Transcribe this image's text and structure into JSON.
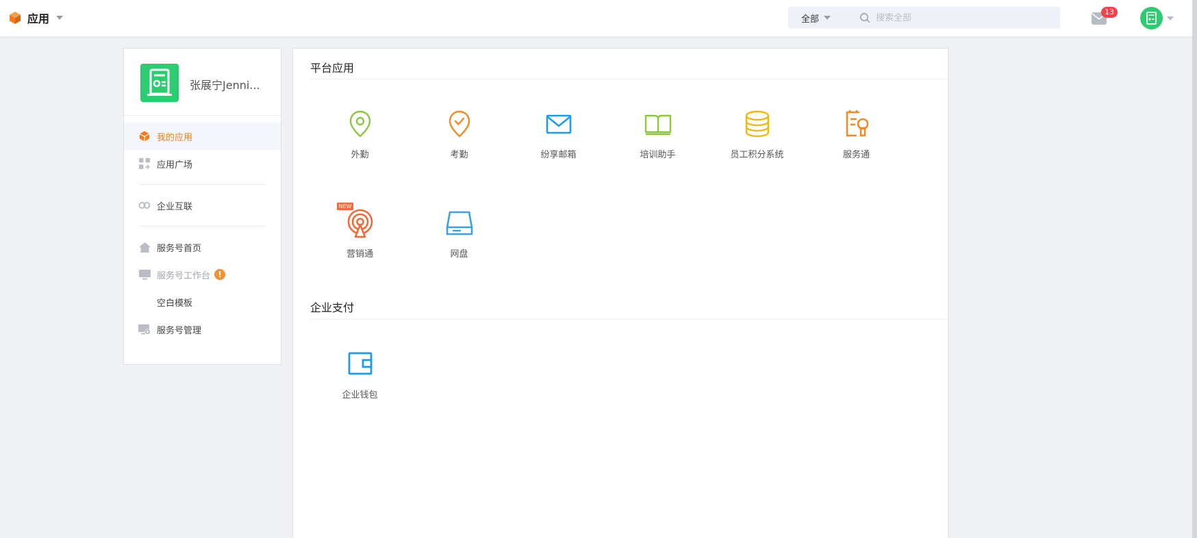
{
  "header": {
    "app_title": "应用",
    "search_scope": "全部",
    "search_placeholder": "搜索全部",
    "mail_badge": "13"
  },
  "sidebar": {
    "org_name": "张展宁Jenni...",
    "items": [
      {
        "label": "我的应用",
        "icon": "cube-icon",
        "active": true
      },
      {
        "label": "应用广场",
        "icon": "grid-plus-icon"
      },
      {
        "label": "企业互联",
        "icon": "link-icon"
      },
      {
        "label": "服务号首页",
        "icon": "home-icon"
      },
      {
        "label": "服务号工作台",
        "icon": "monitor-icon",
        "warning": "!"
      },
      {
        "label": "空白模板"
      },
      {
        "label": "服务号管理",
        "icon": "monitor-gear-icon"
      }
    ]
  },
  "main": {
    "sections": [
      {
        "title": "平台应用",
        "apps": [
          {
            "label": "外勤",
            "icon": "location-pin-icon",
            "color": "#8cc63f"
          },
          {
            "label": "考勤",
            "icon": "check-pin-icon",
            "color": "#f08a24"
          },
          {
            "label": "纷享邮箱",
            "icon": "envelope-icon",
            "color": "#1e9be8"
          },
          {
            "label": "培训助手",
            "icon": "book-icon",
            "color": "#8cc63f"
          },
          {
            "label": "员工积分系统",
            "icon": "database-icon",
            "color": "#f5b800"
          },
          {
            "label": "服务通",
            "icon": "service-wrench-icon",
            "color": "#f08a24"
          },
          {
            "label": "营销通",
            "icon": "broadcast-icon",
            "color": "#f26a3b",
            "tag": "NEW"
          },
          {
            "label": "网盘",
            "icon": "hard-drive-icon",
            "color": "#3aa0e8"
          }
        ]
      },
      {
        "title": "企业支付",
        "apps": [
          {
            "label": "企业钱包",
            "icon": "wallet-icon",
            "color": "#1e9be8"
          }
        ]
      }
    ]
  },
  "colors": {
    "accent": "#f07c1f",
    "background": "#f0f1f4",
    "badge": "#f5414a",
    "avatar_green": "#2ecc71"
  }
}
